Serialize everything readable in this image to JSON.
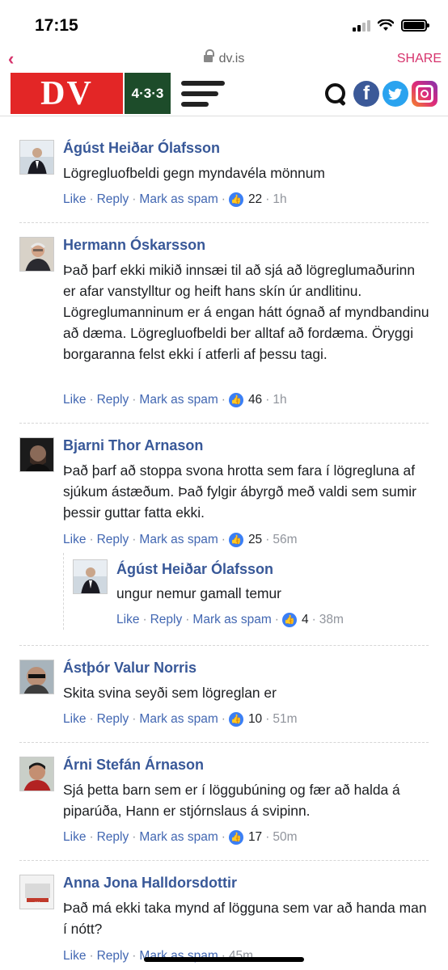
{
  "status": {
    "time": "17:15"
  },
  "browser": {
    "url": "dv.is",
    "share_label": "SHARE"
  },
  "header": {
    "dv_logo": "DV",
    "logo_433": "4·3·3",
    "facebook_glyph": "f",
    "twitter_glyph": "t"
  },
  "comments": [
    {
      "name": "Ágúst Heiðar Ólafsson",
      "text": "Lögregluofbeldi gegn myndavéla mönnum",
      "like": "Like",
      "reply": "Reply",
      "spam": "Mark as spam",
      "likes": "22",
      "time": "1h"
    },
    {
      "name": "Hermann Óskarsson",
      "text": "Það þarf ekki mikið innsæi til að sjá að lögreglumaðurinn er afar vanstylltur og heift hans skín úr andlitinu. Lögreglumanninum er á engan hátt ógnað af myndbandinu að dæma. Lögregluofbeldi ber alltaf að fordæma. Öryggi borgaranna felst ekki í atferli af þessu tagi.",
      "like": "Like",
      "reply": "Reply",
      "spam": "Mark as spam",
      "likes": "46",
      "time": "1h"
    },
    {
      "name": "Bjarni Thor Arnason",
      "text": "Það þarf að stoppa svona hrotta sem fara í lögregluna af sjúkum ástæðum. Það fylgir ábyrgð með valdi sem sumir þessir guttar fatta ekki.",
      "like": "Like",
      "reply": "Reply",
      "spam": "Mark as spam",
      "likes": "25",
      "time": "56m",
      "reply_comment": {
        "name": "Ágúst Heiðar Ólafsson",
        "text": "ungur nemur gamall temur",
        "like": "Like",
        "reply": "Reply",
        "spam": "Mark as spam",
        "likes": "4",
        "time": "38m"
      }
    },
    {
      "name": "Ástþór Valur Norris",
      "text": "Skita svina seyði sem lögreglan er",
      "like": "Like",
      "reply": "Reply",
      "spam": "Mark as spam",
      "likes": "10",
      "time": "51m"
    },
    {
      "name": "Árni Stefán Árnason",
      "text": "Sjá þetta barn sem er í löggubúning og fær að halda á piparúða, Hann er stjórnslaus á svipinn.",
      "like": "Like",
      "reply": "Reply",
      "spam": "Mark as spam",
      "likes": "17",
      "time": "50m"
    },
    {
      "name": "Anna Jona Halldorsdottir",
      "text": "Það má ekki taka mynd af lögguna sem var að handa man í nótt?",
      "like": "Like",
      "reply": "Reply",
      "spam": "Mark as spam",
      "likes": "",
      "time": "45m"
    }
  ],
  "colors": {
    "accent": "#d6336c",
    "link": "#4267b2",
    "name": "#385898",
    "dv_red": "#e32626",
    "green_433": "#1d4c2a"
  }
}
